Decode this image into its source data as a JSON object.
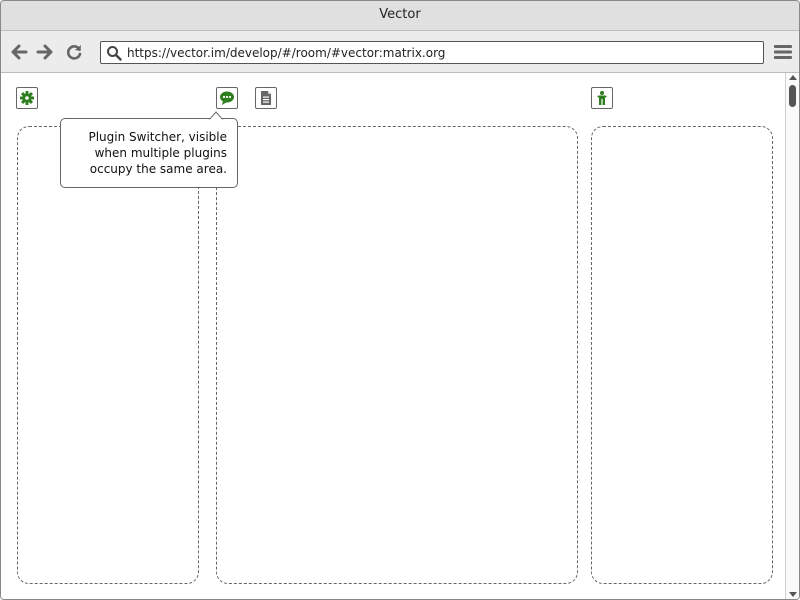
{
  "window": {
    "title": "Vector"
  },
  "toolbar": {
    "back_icon": "arrow-left-icon",
    "forward_icon": "arrow-right-icon",
    "reload_icon": "reload-icon",
    "url": "https://vector.im/develop/#/room/#vector:matrix.org",
    "menu_icon": "hamburger-menu-icon"
  },
  "plugins": {
    "settings_icon": "gear-icon",
    "chat_icon": "chat-bubble-icon",
    "document_icon": "document-icon",
    "member_icon": "person-icon"
  },
  "tooltip": {
    "lines": [
      "Plugin Switcher, visible",
      "when multiple plugins",
      "occupy the same area."
    ]
  },
  "colors": {
    "icon_green": "#2e7d1e",
    "icon_gray": "#666666",
    "dashed_border": "#666666"
  }
}
